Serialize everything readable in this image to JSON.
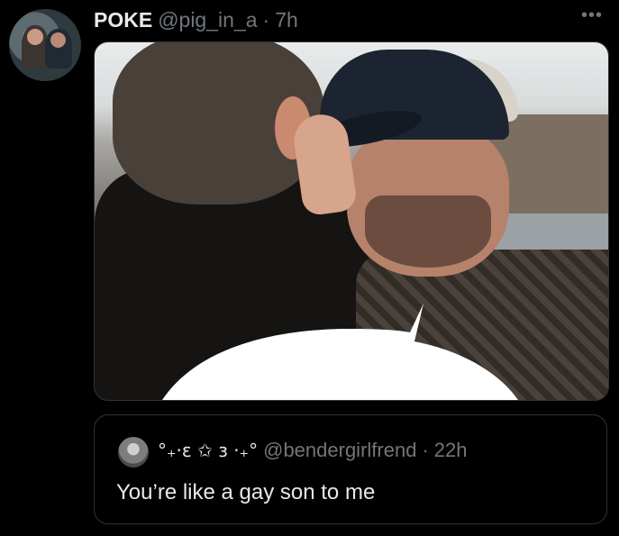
{
  "tweet": {
    "display_name": "POKE",
    "handle": "@pig_in_a",
    "separator": "·",
    "time": "7h",
    "more_icon": "more-icon"
  },
  "quoted_tweet": {
    "display_name": "°₊·ɛ︎ ✩ ɜ ·₊°",
    "handle": "@bendergirlfrend",
    "separator": "·",
    "time": "22h",
    "text": "You’re like a gay son to me"
  }
}
